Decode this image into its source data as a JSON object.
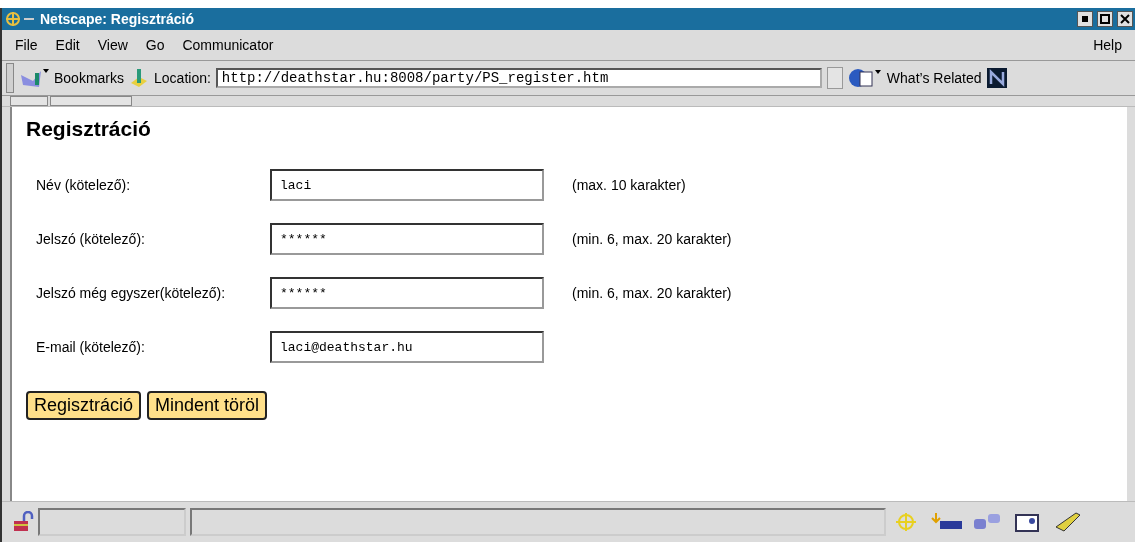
{
  "window": {
    "title": "Netscape: Regisztráció"
  },
  "menu": [
    {
      "label": "File"
    },
    {
      "label": "Edit"
    },
    {
      "label": "View"
    },
    {
      "label": "Go"
    },
    {
      "label": "Communicator"
    }
  ],
  "help_menu": {
    "label": "Help"
  },
  "toolbar": {
    "bookmarks": "Bookmarks",
    "location_label": "Location:",
    "url": "http://deathstar.hu:8008/party/PS_register.htm",
    "whats_related": "What’s Related"
  },
  "page": {
    "heading": "Regisztráció",
    "fields": [
      {
        "label": "Név (kötelező):",
        "value": "laci",
        "hint": "(max. 10 karakter)"
      },
      {
        "label": "Jelszó (kötelező):",
        "value": "******",
        "hint": "(min. 6, max. 20 karakter)"
      },
      {
        "label": "Jelszó még egyszer(kötelező):",
        "value": "******",
        "hint": "(min. 6, max. 20 karakter)"
      },
      {
        "label": "E-mail (kötelező):",
        "value": "laci@deathstar.hu"
      }
    ],
    "buttons": [
      {
        "label": "Regisztráció"
      },
      {
        "label": "Mindent töröl"
      }
    ]
  }
}
